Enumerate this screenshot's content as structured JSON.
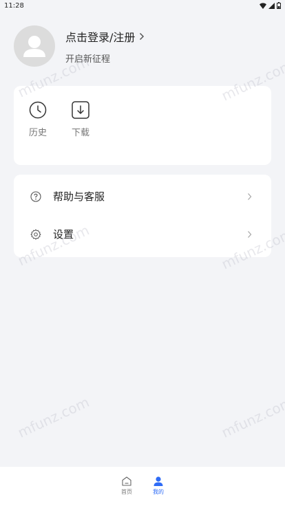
{
  "status_bar": {
    "time": "11:28"
  },
  "profile": {
    "login_label": "点击登录/注册",
    "subtitle": "开启新征程"
  },
  "quick_actions": [
    {
      "label": "历史",
      "icon": "clock-icon"
    },
    {
      "label": "下载",
      "icon": "download-icon"
    }
  ],
  "menu": [
    {
      "label": "帮助与客服",
      "icon": "help-icon"
    },
    {
      "label": "设置",
      "icon": "gear-icon"
    }
  ],
  "watermark": "mfunz.com",
  "tabbar": [
    {
      "label": "首页",
      "icon": "home-icon",
      "active": false
    },
    {
      "label": "我的",
      "icon": "user-icon",
      "active": true
    }
  ],
  "colors": {
    "accent": "#2f6cf6",
    "background": "#f3f4f7"
  }
}
